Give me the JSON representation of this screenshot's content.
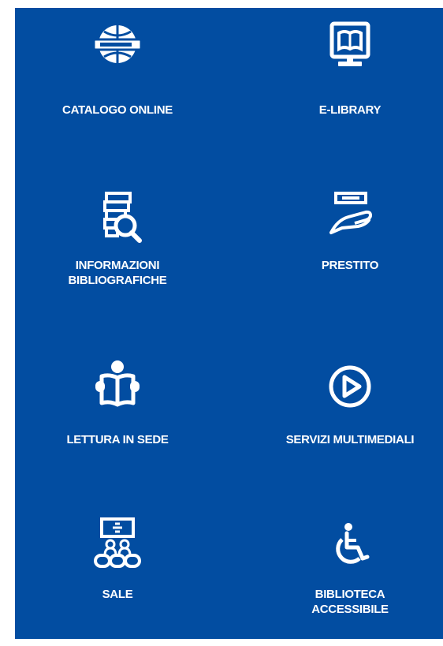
{
  "theme": {
    "background": "#024da1",
    "text": "#ffffff"
  },
  "services": [
    {
      "lines": [
        "CATALOGO ONLINE"
      ],
      "icon": "globe-catalog-icon"
    },
    {
      "lines": [
        "E-LIBRARY"
      ],
      "icon": "monitor-book-icon"
    },
    {
      "lines": [
        "INFORMAZIONI",
        "BIBLIOGRAFICHE"
      ],
      "icon": "books-search-icon"
    },
    {
      "lines": [
        "PRESTITO"
      ],
      "icon": "hand-book-icon"
    },
    {
      "lines": [
        "LETTURA IN SEDE"
      ],
      "icon": "reader-book-icon"
    },
    {
      "lines": [
        "SERVIZI MULTIMEDIALI"
      ],
      "icon": "play-circle-icon"
    },
    {
      "lines": [
        "SALE"
      ],
      "icon": "meeting-room-icon"
    },
    {
      "lines": [
        "BIBLIOTECA",
        "ACCESSIBILE"
      ],
      "icon": "wheelchair-icon"
    }
  ]
}
